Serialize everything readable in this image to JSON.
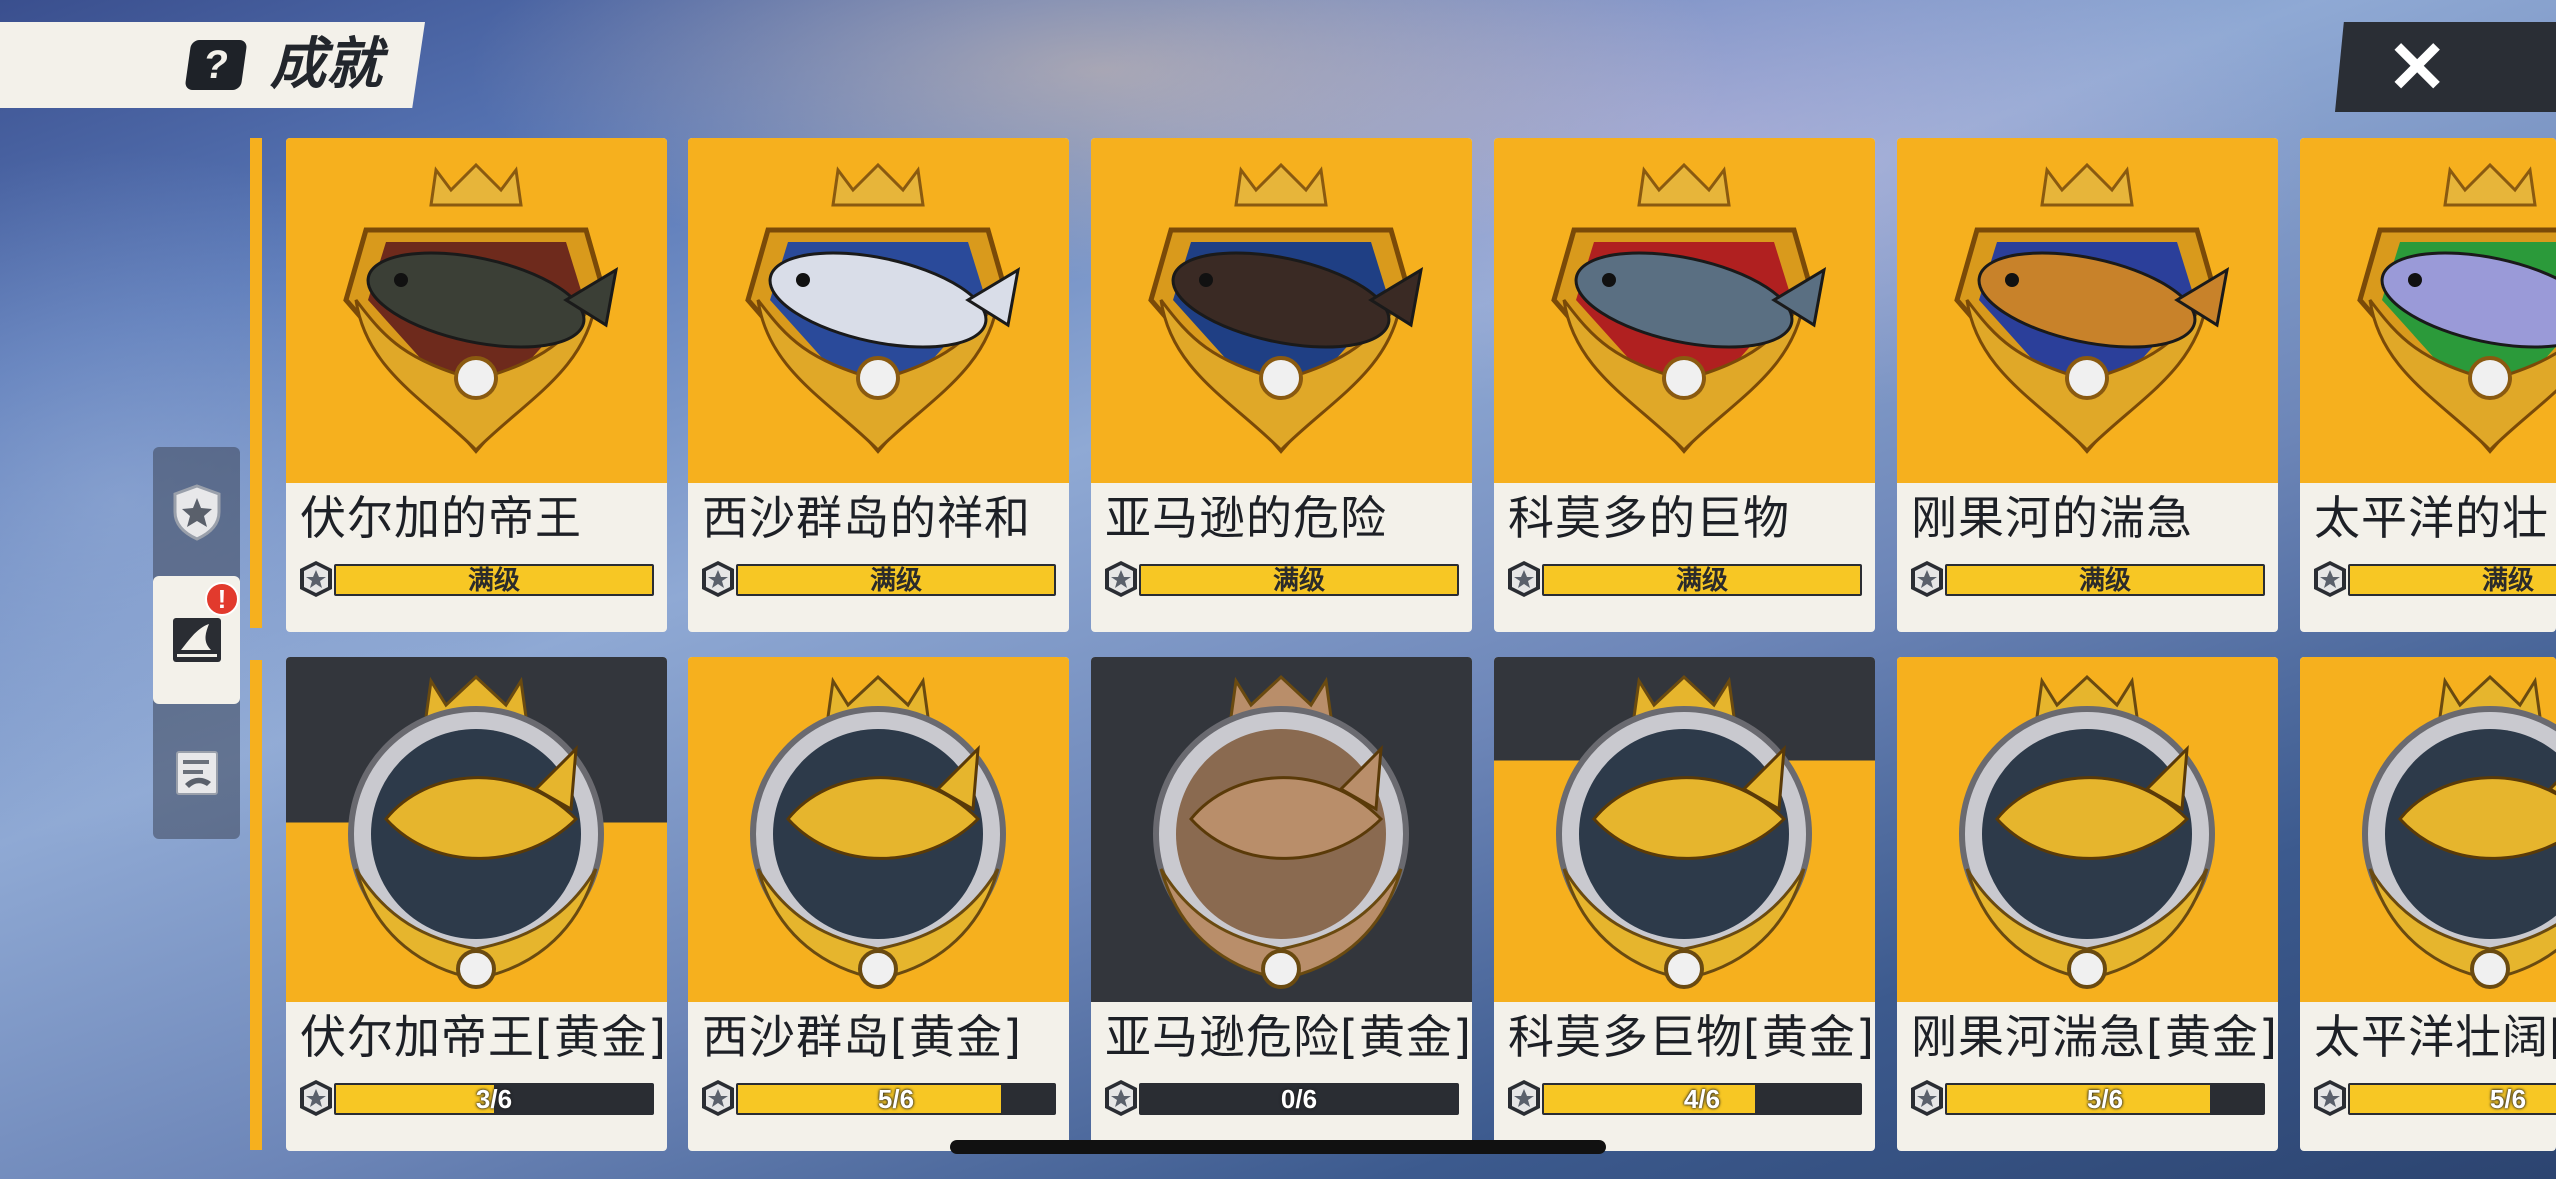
{
  "header": {
    "title": "成就",
    "help_icon": "?",
    "close_icon": "✕"
  },
  "side_tabs": [
    {
      "name": "badge-tab",
      "icon": "shield-star-icon",
      "active": false
    },
    {
      "name": "fish-tab",
      "icon": "fish-fin-icon",
      "active": true,
      "badge": "!"
    },
    {
      "name": "notes-tab",
      "icon": "fish-notes-icon",
      "active": false
    }
  ],
  "top_row": [
    {
      "name": "伏尔加的帝王",
      "progress": "满级",
      "fill": 1.0,
      "fish_color": "#3b3f36",
      "accent": "#6e2a1c"
    },
    {
      "name": "西沙群岛的祥和",
      "progress": "满级",
      "fill": 1.0,
      "fish_color": "#d9dde8",
      "accent": "#2a4a9a"
    },
    {
      "name": "亚马逊的危险",
      "progress": "满级",
      "fill": 1.0,
      "fish_color": "#3a2a24",
      "accent": "#1f3f84"
    },
    {
      "name": "科莫多的巨物",
      "progress": "满级",
      "fill": 1.0,
      "fish_color": "#5a6f82",
      "accent": "#b02020"
    },
    {
      "name": "刚果河的湍急",
      "progress": "满级",
      "fill": 1.0,
      "fish_color": "#c8822a",
      "accent": "#2b3f9a"
    },
    {
      "name": "太平洋的壮",
      "progress": "满级",
      "fill": 1.0,
      "fish_color": "#9a9ad8",
      "accent": "#2b9a3a"
    }
  ],
  "bottom_row": [
    {
      "name": "伏尔加帝王[黄金]",
      "progress": "3/6",
      "fill": 0.5,
      "bg": "half"
    },
    {
      "name": "西沙群岛[黄金]",
      "progress": "5/6",
      "fill": 0.833,
      "bg": "gold"
    },
    {
      "name": "亚马逊危险[黄金]",
      "progress": "0/6",
      "fill": 0.0,
      "bg": "dark"
    },
    {
      "name": "科莫多巨物[黄金]",
      "progress": "4/6",
      "fill": 0.667,
      "bg": "half2"
    },
    {
      "name": "刚果河湍急[黄金]",
      "progress": "5/6",
      "fill": 0.833,
      "bg": "gold"
    },
    {
      "name": "太平洋壮阔[",
      "progress": "5/6",
      "fill": 0.833,
      "bg": "gold"
    }
  ],
  "colors": {
    "gold": "#f6b01e",
    "bar_fill": "#f7c724",
    "bar_bg": "#2a2d33",
    "card_bg": "#f3f1ea"
  }
}
